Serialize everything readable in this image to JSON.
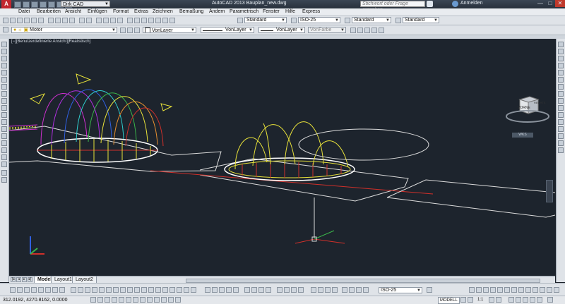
{
  "window": {
    "app_menu_label": "A",
    "workspace": "Dirk CAD",
    "title": "AutoCAD 2013   Bauplan_new.dwg",
    "search_placeholder": "Stichwort oder Frage eingeben",
    "login_label": "Anmelden",
    "controls": [
      "—",
      "□",
      "✕"
    ]
  },
  "menu": [
    "Datei",
    "Bearbeiten",
    "Ansicht",
    "Einfügen",
    "Format",
    "Extras",
    "Zeichnen",
    "Bemaßung",
    "Ändern",
    "Parametrisch",
    "Fenster",
    "Hilfe",
    "Express"
  ],
  "styles_toolbar": {
    "text_style": "Standard",
    "dim_style": "ISO-25",
    "table_style": "Standard",
    "multileader_style": "Standard"
  },
  "layer_toolbar": {
    "layer": "Motor",
    "color": "VonLayer",
    "linetype": "VonLayer",
    "lineweight": "VonLayer",
    "plotstyle": "VonFarbe"
  },
  "viewport": {
    "label": "[−][Benutzerdefinierte Ansicht][Realistisch]",
    "viewcube_face": "VORNE",
    "viewcube_side": "RECHTS",
    "wcs_label": "WKS",
    "colors": {
      "background": "#1d242d",
      "white": "#e8e8e8",
      "yellow": "#e8e23a",
      "red": "#d0302a",
      "green": "#3ab54a",
      "blue": "#3060e0",
      "magenta": "#d030d0",
      "cyan": "#30d0d0"
    }
  },
  "tabs": [
    "Modell",
    "Layout1",
    "Layout2"
  ],
  "bottom_toolbar": {
    "dim_style": "ISO-25"
  },
  "status": {
    "coords": "312.0192, 4270.8162, 0.0000",
    "space": "MODELL",
    "scale": "1:1"
  }
}
